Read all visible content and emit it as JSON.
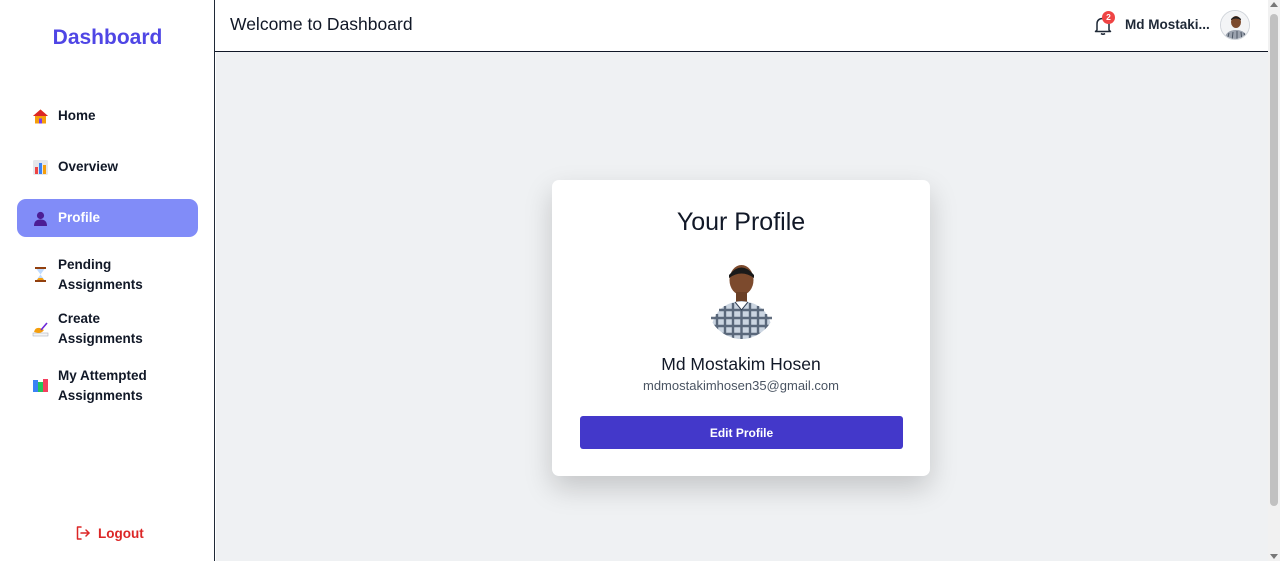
{
  "sidebar": {
    "brand": "Dashboard",
    "items": [
      {
        "label": "Home",
        "icon": "house-icon"
      },
      {
        "label": "Overview",
        "icon": "bar-chart-icon"
      },
      {
        "label": "Profile",
        "icon": "person-icon",
        "active": true
      },
      {
        "label": "Pending Assignments",
        "line1": "Pending",
        "line2": "Assignments",
        "icon": "hourglass-icon"
      },
      {
        "label": "Create Assignments",
        "icon": "writing-hand-icon"
      },
      {
        "label": "My Attempted Assignments",
        "line1": "My Attempted",
        "line2": "Assignments",
        "icon": "books-icon"
      }
    ],
    "logout_label": "Logout"
  },
  "header": {
    "title": "Welcome to Dashboard",
    "notification_count": "2",
    "user_name": "Md Mostaki..."
  },
  "profile_card": {
    "title": "Your Profile",
    "name": "Md Mostakim Hosen",
    "email": "mdmostakimhosen35@gmail.com",
    "edit_button": "Edit Profile"
  },
  "colors": {
    "brand": "#4f46e5",
    "active_nav": "#818cf8",
    "button": "#4338ca",
    "logout": "#dc2626",
    "badge": "#ef4444",
    "main_bg": "#eff1f3"
  }
}
